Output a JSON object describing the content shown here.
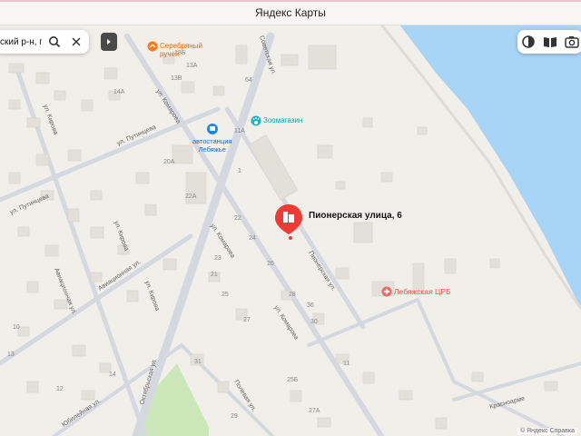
{
  "window": {
    "title": "Яндекс Карты"
  },
  "search": {
    "value": "ский р-н, г",
    "icon_search": "search-icon",
    "icon_clear": "close-icon"
  },
  "toolbar": {
    "icons": [
      "layers-icon",
      "book-icon",
      "camera-icon"
    ]
  },
  "pois": {
    "address": "Пионерская улица, 6",
    "zoo": "Зоомагазин",
    "stream": "Серебряный ручей",
    "station_line1": "автостанция",
    "station_line2": "Лебяжье",
    "hospital": "Лебяжская ЦРБ"
  },
  "streets": {
    "sovetskaya": "Советская ул.",
    "komarova_1": "ул. Комарова",
    "komarova_2": "ул. Комарова",
    "komarova_3": "ул. Комарова",
    "putintseva_1": "ул. Путинцева",
    "putintseva_2": "ул. Путинцева",
    "kirova_1": "ул. Кирова",
    "kirova_2": "ул. Кирова",
    "kirova_3": "ул. Кирова",
    "pionerskaya": "Пионерская ул.",
    "aviatsionnaya_1": "Авиационная ул.",
    "aviatsionnaya_2": "Авиационная ул.",
    "oktyabrskaya": "Октябрьская ул.",
    "polevaya": "Полевая ул.",
    "yubileynaya": "Юбилейная ул.",
    "krasnoarm": "Красноарме"
  },
  "house_numbers": [
    "13Б",
    "13В",
    "13А",
    "14А",
    "64",
    "11А",
    "20А",
    "22А",
    "22",
    "24",
    "26",
    "28",
    "36",
    "30",
    "21",
    "25",
    "23",
    "27",
    "11",
    "1",
    "25Б",
    "27А",
    "31",
    "14",
    "10",
    "13",
    "12",
    "29"
  ],
  "footer": {
    "copyright": "© Яндекс  Справка"
  },
  "colors": {
    "water": "#a8d4f5",
    "road": "#d5d8df",
    "land": "#f1efea",
    "building": "#e3e0da",
    "marker": "#ef3b34",
    "poi_orange": "#ff7a1a",
    "poi_blue": "#1e88e5",
    "poi_teal": "#1ab4c4",
    "hospital": "#f46a61"
  }
}
